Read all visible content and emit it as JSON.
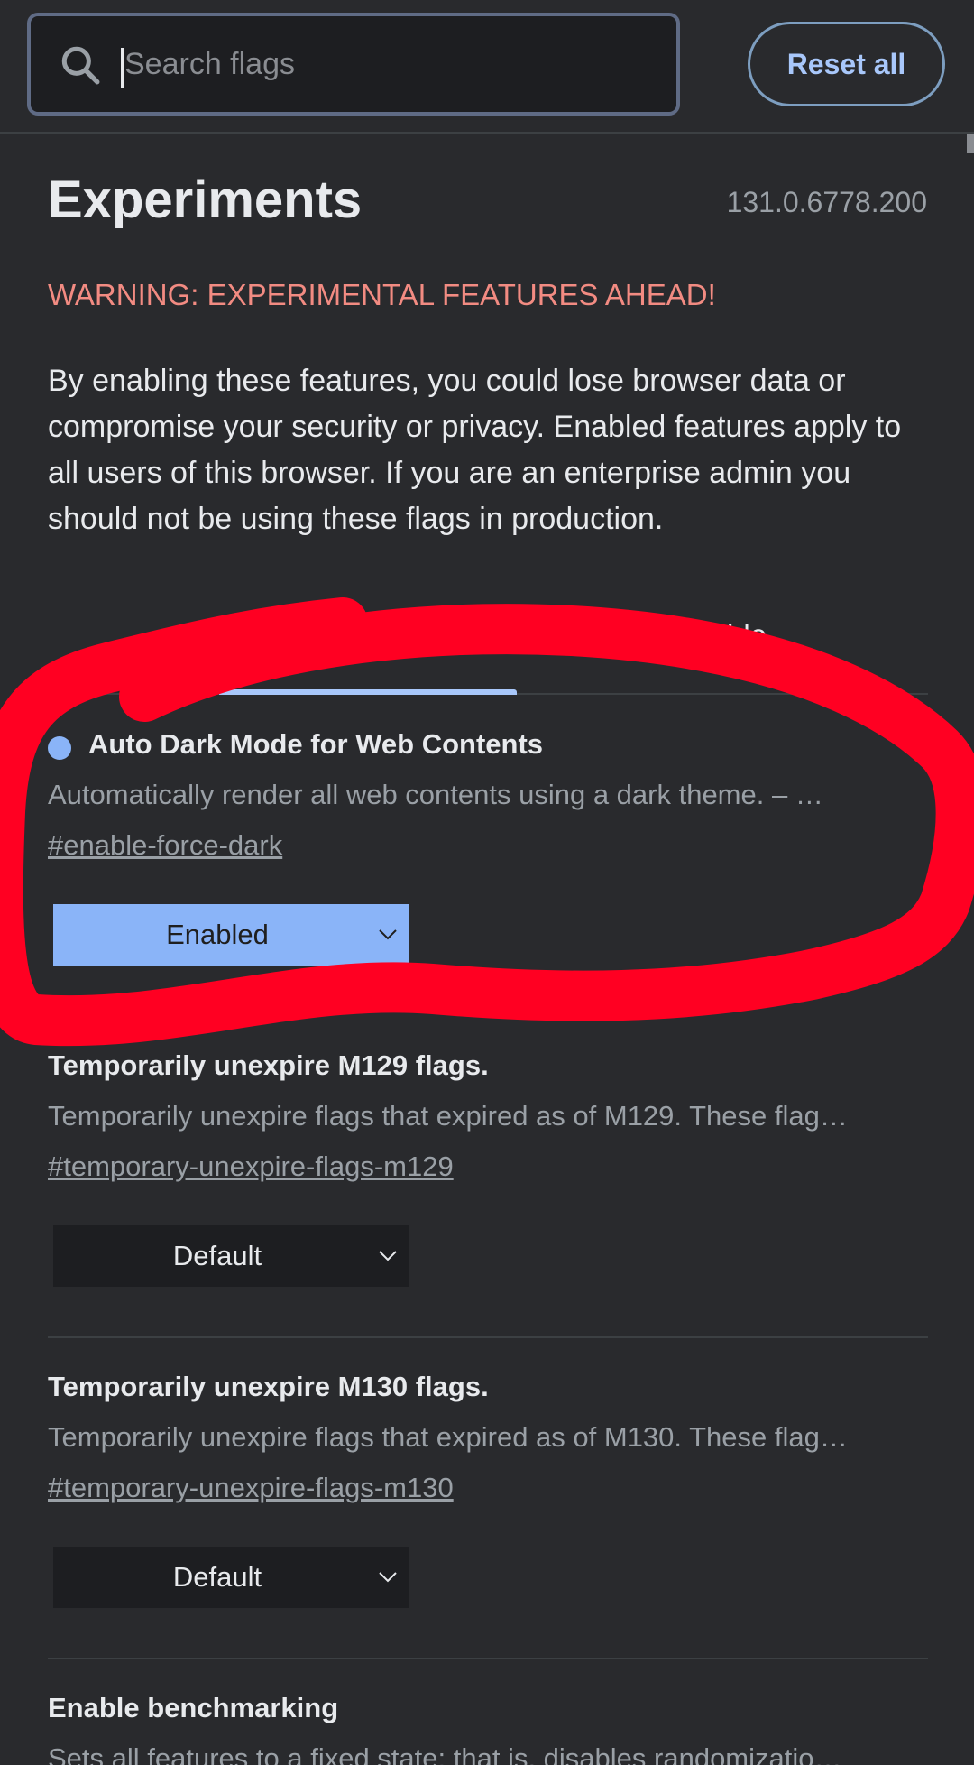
{
  "search": {
    "placeholder": "Search flags",
    "value": ""
  },
  "header": {
    "reset_label": "Reset all"
  },
  "page": {
    "title": "Experiments",
    "version": "131.0.6778.200",
    "warning": "WARNING: EXPERIMENTAL FEATURES AHEAD!",
    "description": "By enabling these features, you could lose browser data or compromise your security or privacy. Enabled features apply to all users of this browser. If you are an enterprise admin you should not be using these flags in production."
  },
  "tabs": {
    "partial_label": "ilable"
  },
  "flags": [
    {
      "name": "Auto Dark Mode for Web Contents",
      "description": "Automatically render all web contents using a dark theme. – …",
      "link": "#enable-force-dark",
      "value": "Enabled",
      "modified": true
    },
    {
      "name": "Temporarily unexpire M129 flags.",
      "description": "Temporarily unexpire flags that expired as of M129. These flag…",
      "link": "#temporary-unexpire-flags-m129",
      "value": "Default",
      "modified": false
    },
    {
      "name": "Temporarily unexpire M130 flags.",
      "description": "Temporarily unexpire flags that expired as of M130. These flag…",
      "link": "#temporary-unexpire-flags-m130",
      "value": "Default",
      "modified": false
    },
    {
      "name": "Enable benchmarking",
      "description": "Sets all features to a fixed state; that is, disables randomizatio…"
    }
  ],
  "colors": {
    "background": "#292a2d",
    "accent": "#8ab4f8",
    "warning": "#f28b82",
    "annotation": "#ff0022"
  },
  "icons": {
    "search": "search-icon",
    "dropdown": "chevron-down-icon",
    "modified": "dot-icon"
  }
}
